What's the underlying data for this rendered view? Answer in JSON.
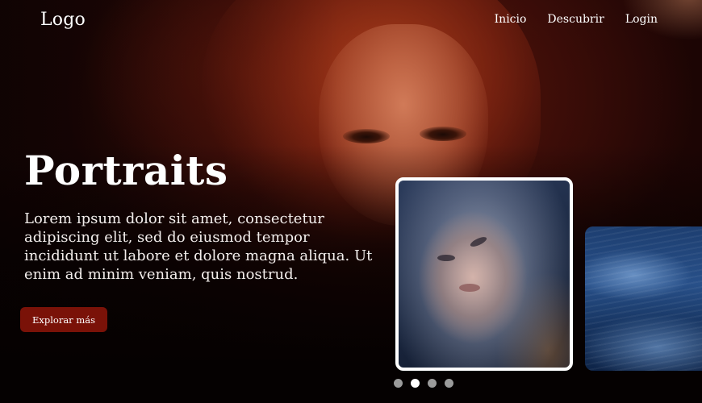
{
  "header": {
    "logo": "Logo",
    "nav": [
      {
        "label": "Inicio"
      },
      {
        "label": "Descubrir"
      },
      {
        "label": "Login"
      }
    ]
  },
  "hero": {
    "title": "Portraits",
    "description": "Lorem ipsum dolor sit amet, consectetur adipiscing elit, sed do eiusmod tempor incididunt ut labore et dolore magna aliqua. Ut enim ad minim veniam, quis nostrud.",
    "cta_label": "Explorar más"
  },
  "carousel": {
    "slides_count": 4,
    "active_index": 1
  },
  "colors": {
    "cta_background": "#7a1208",
    "active_dot": "#ffffff",
    "inactive_dot": "#9b9b9b"
  }
}
